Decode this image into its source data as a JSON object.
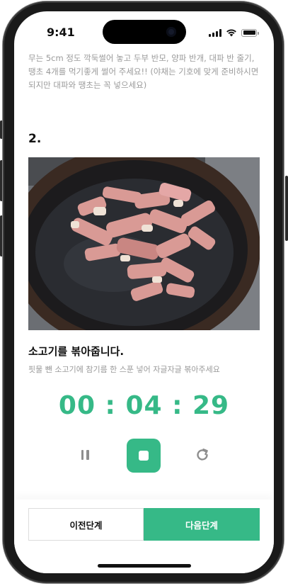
{
  "status_bar": {
    "time": "9:41"
  },
  "previous_step": {
    "text": "무는 5cm 정도 깍둑썰어 놓고 두부 반모, 양파 반개, 대파 반 줄기, 땡초 4개를 먹기좋게 썰어 주세요!! (야채는 기호에 맞게 준비하시면 되지만 대파와 땡초는 꼭 넣으세요)"
  },
  "step": {
    "number": "2.",
    "title": "소고기를 볶아줍니다.",
    "description": "핏물 뺀 소고기에 참기름 한 스푼 넣어 자글자글 볶아주세요"
  },
  "timer": {
    "display": "00 : 04 : 29"
  },
  "controls": {
    "pause_icon": "pause-icon",
    "stop_icon": "stop-icon",
    "restart_icon": "restart-icon"
  },
  "footer": {
    "prev_label": "이전단계",
    "next_label": "다음단계"
  },
  "colors": {
    "accent": "#36b987",
    "muted_text": "#9a9a9a",
    "text": "#111111"
  }
}
